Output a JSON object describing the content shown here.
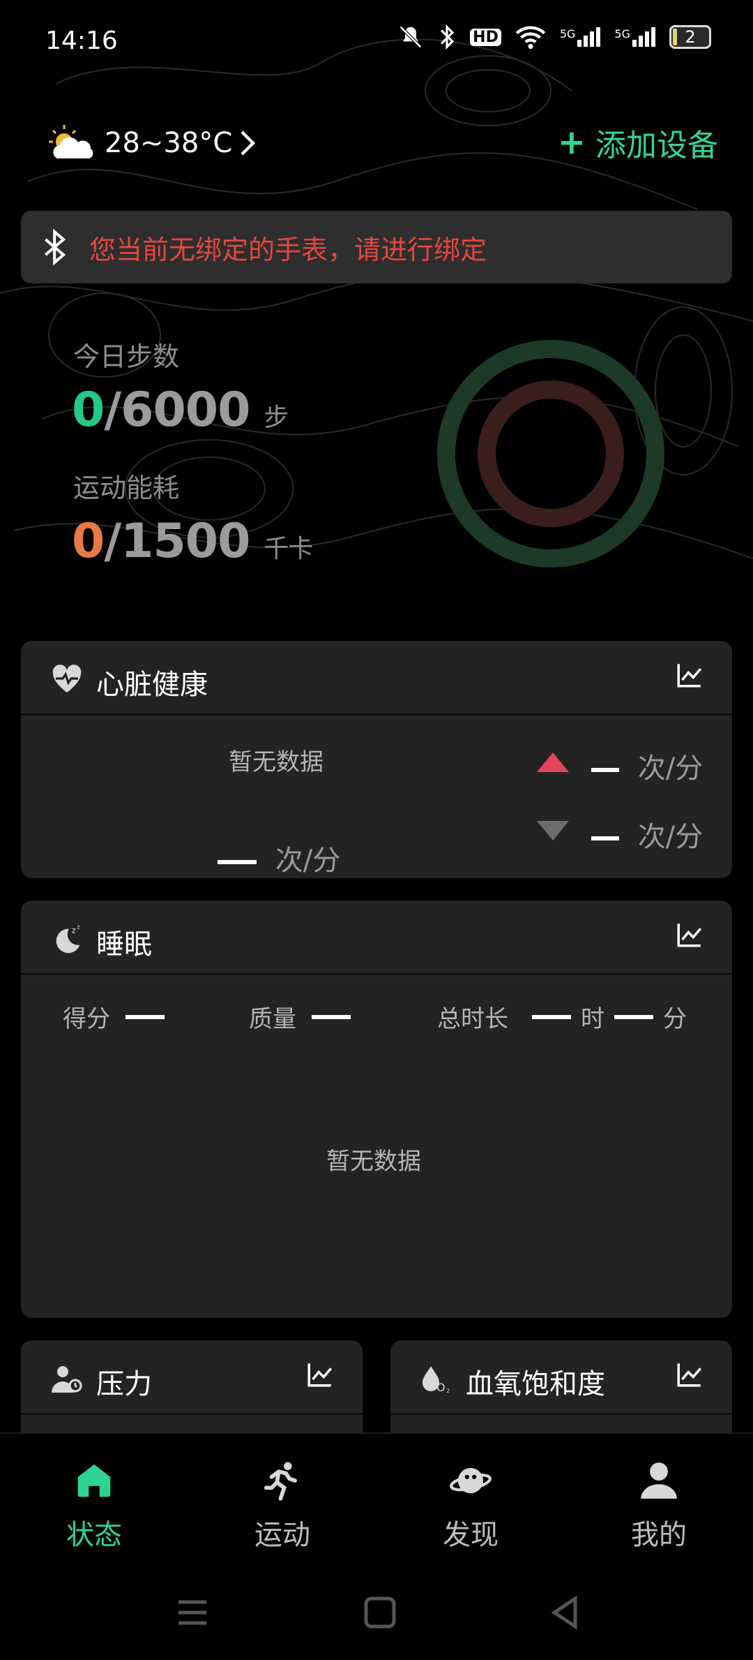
{
  "status_bar": {
    "time": "14:16",
    "battery_level": "2",
    "signal_labels": [
      "5G",
      "5G"
    ],
    "hd_label": "HD"
  },
  "weather": {
    "temperature": "28~38°C",
    "icon": "partly-cloudy-icon"
  },
  "header": {
    "add_device_label": "添加设备"
  },
  "banner": {
    "message": "您当前无绑定的手表，请进行绑定"
  },
  "activity": {
    "steps_label": "今日步数",
    "steps_current": "0",
    "steps_goal": "/6000",
    "steps_unit": "步",
    "energy_label": "运动能耗",
    "energy_current": "0",
    "energy_goal": "/1500",
    "energy_unit": "千卡",
    "steps_progress": 0,
    "energy_progress": 0
  },
  "heart": {
    "title": "心脏健康",
    "no_data": "暂无数据",
    "unit": "次/分",
    "high_unit": "次/分",
    "low_unit": "次/分"
  },
  "sleep": {
    "title": "睡眠",
    "score_label": "得分",
    "quality_label": "质量",
    "duration_label": "总时长",
    "hour_label": "时",
    "minute_label": "分",
    "no_data": "暂无数据"
  },
  "stress": {
    "title": "压力"
  },
  "spo2": {
    "title": "血氧饱和度"
  },
  "nav": {
    "tabs": [
      {
        "label": "状态",
        "icon": "home-icon",
        "active": true
      },
      {
        "label": "运动",
        "icon": "running-icon",
        "active": false
      },
      {
        "label": "发现",
        "icon": "planet-icon",
        "active": false
      },
      {
        "label": "我的",
        "icon": "user-icon",
        "active": false
      }
    ]
  },
  "colors": {
    "accent_green": "#25c983",
    "warning_red": "#e4473f",
    "energy_orange": "#e97a45"
  }
}
